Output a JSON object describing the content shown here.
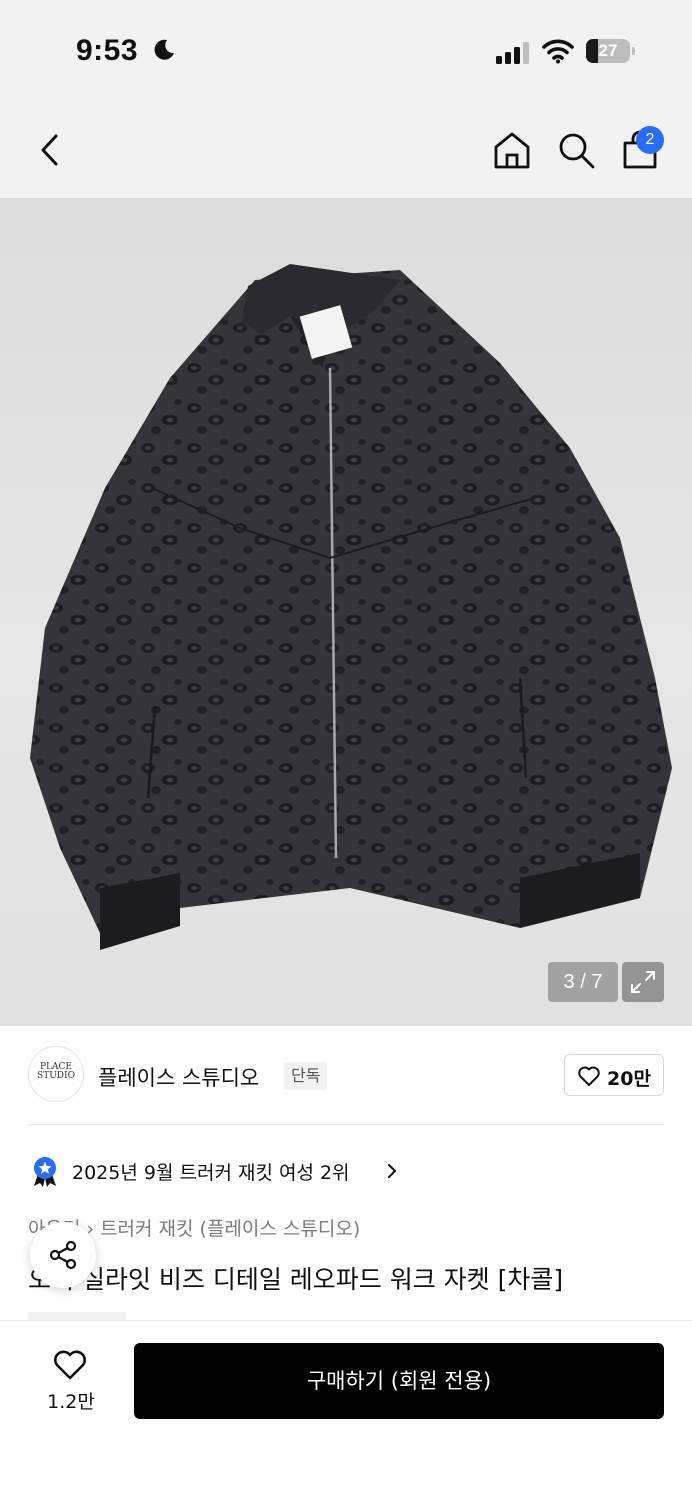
{
  "status_bar": {
    "time": "9:53",
    "battery": "27",
    "battery_level": 0.27
  },
  "nav": {
    "cart_count": "2"
  },
  "gallery": {
    "counter": "3 / 7",
    "current": 3,
    "total": 7
  },
  "brand": {
    "logo_text": "PLACE STUDIO",
    "name": "플레이스 스튜디오",
    "tag": "단독",
    "likes": "20만"
  },
  "ranking": {
    "text": "2025년 9월 트러커 재킷 여성 2위"
  },
  "breadcrumb": {
    "items": [
      "아우터",
      "트러커 재킷 (플레이스 스튜디오)"
    ]
  },
  "product": {
    "title": "오버 실라잇 비즈 디테일 레오파드 워크 자켓 [차콜]"
  },
  "bottom_bar": {
    "wish_count": "1.2만",
    "buy_label": "구매하기 (회원 전용)"
  },
  "colors": {
    "accent": "#2a6df4",
    "buy_button": "#000000",
    "jacket": "#2b2b30"
  }
}
